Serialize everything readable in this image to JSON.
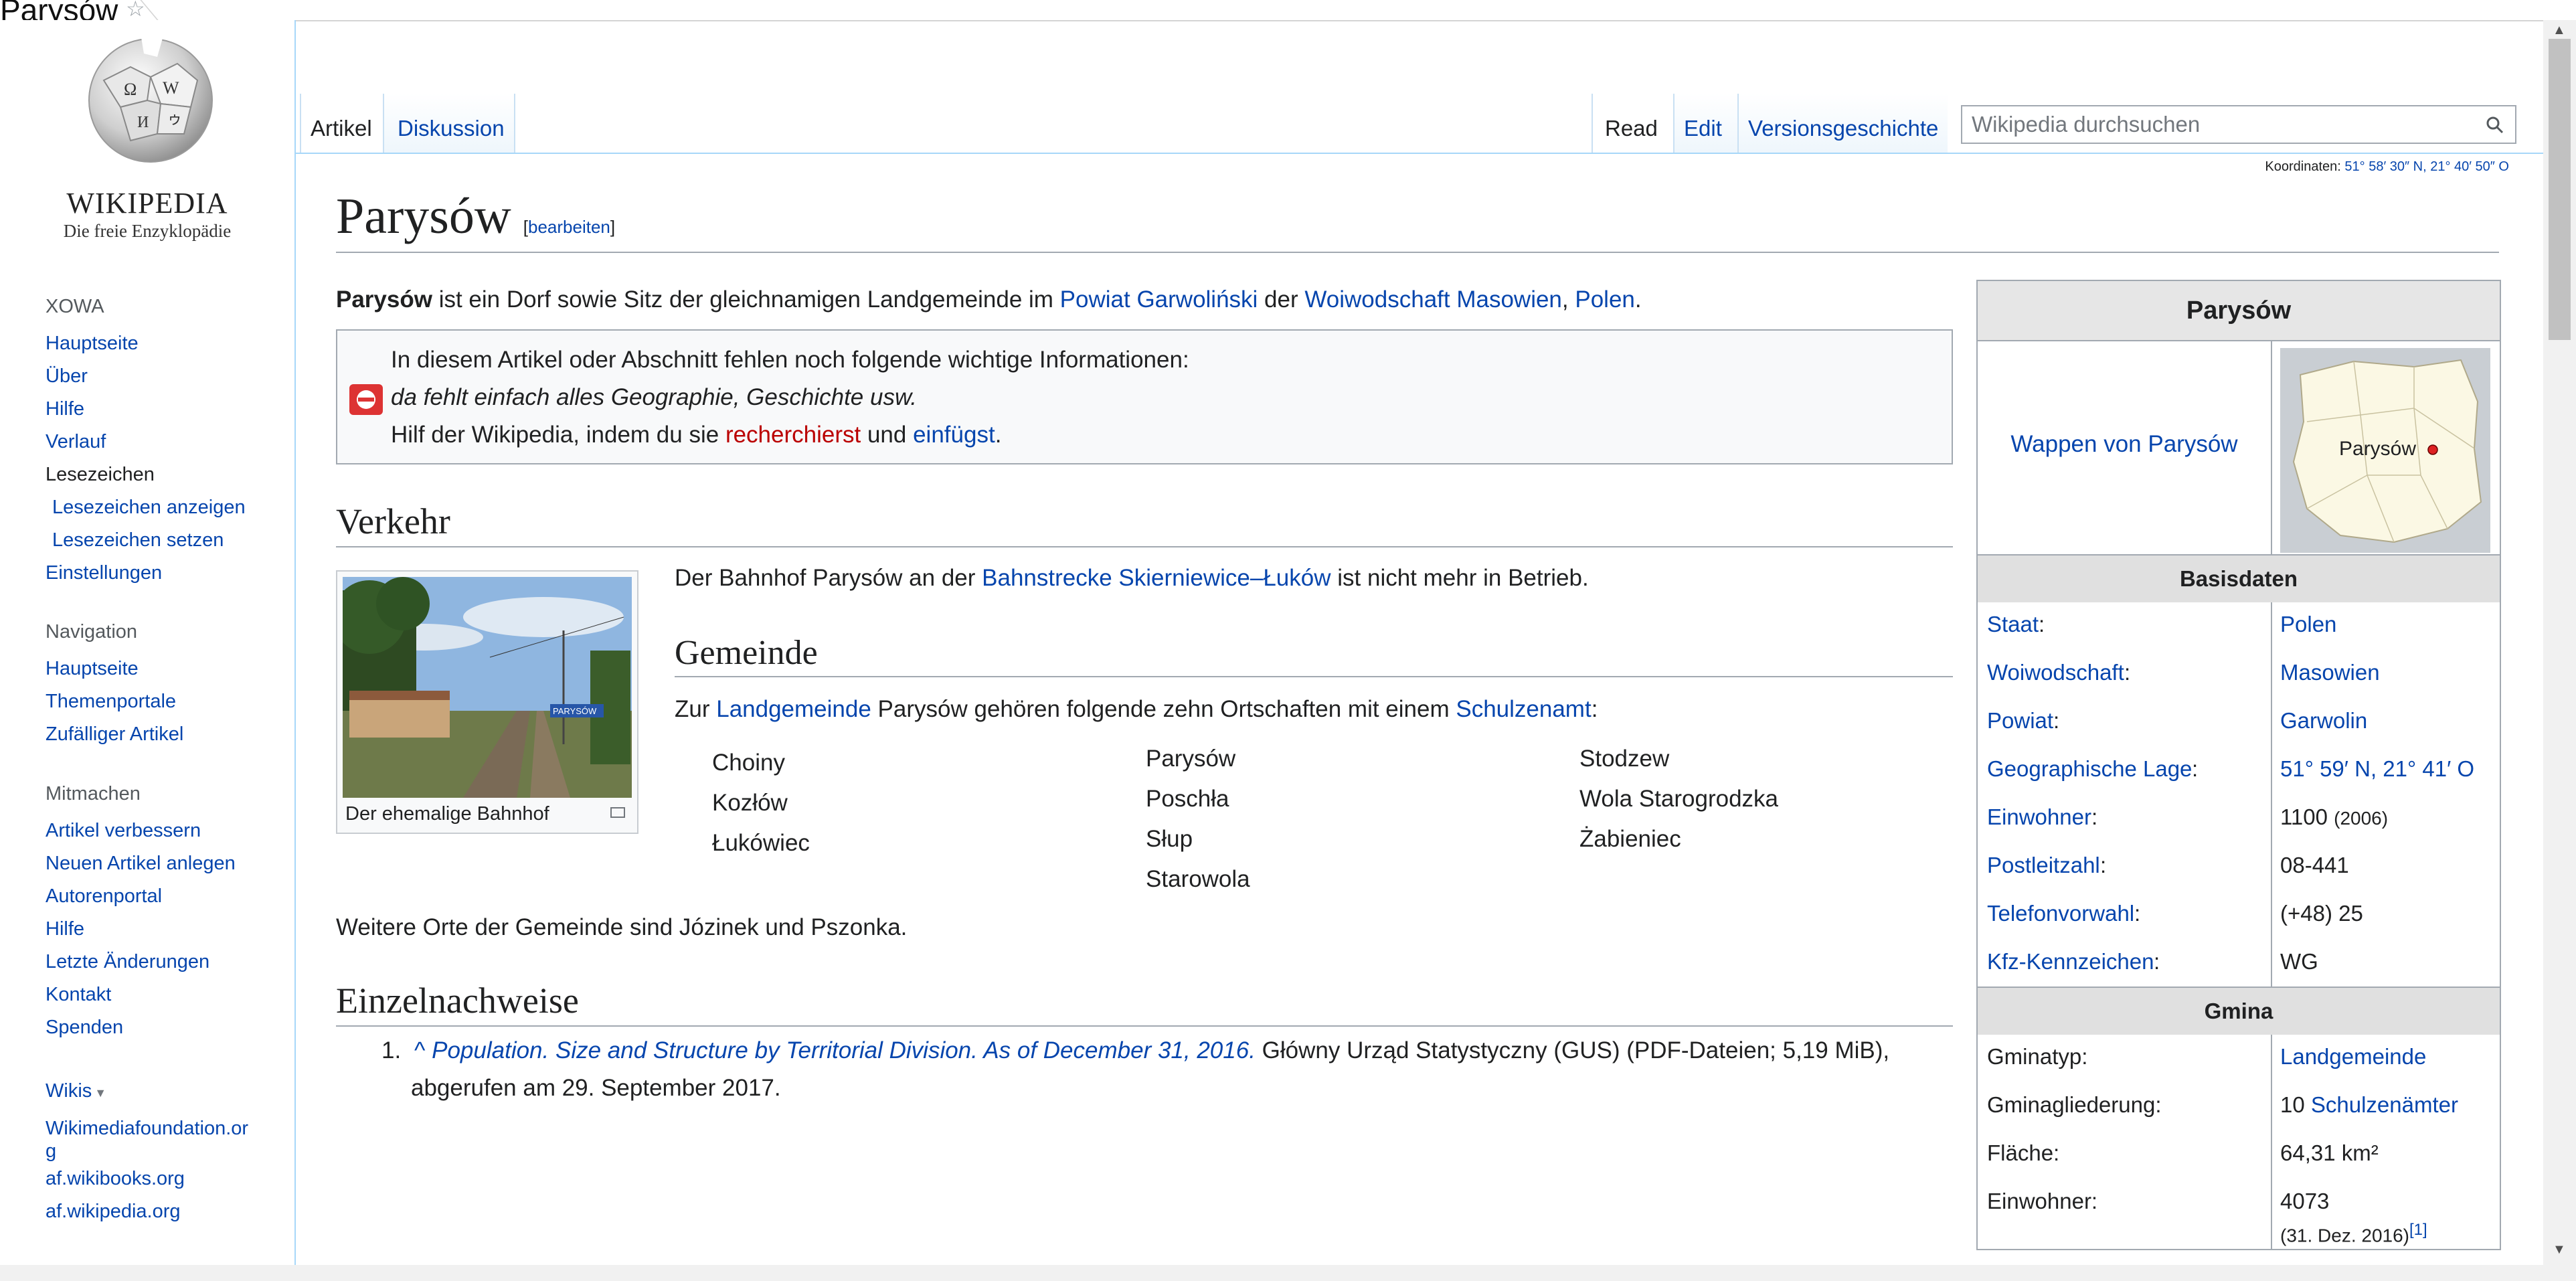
{
  "tab": {
    "title": "Parysów"
  },
  "logo": {
    "wordmark": "WIKIPEDIA",
    "tagline": "Die freie Enzyklopädie"
  },
  "sidebar": {
    "sections": [
      {
        "heading": "XOWA",
        "items": [
          {
            "label": "Hauptseite",
            "type": "link"
          },
          {
            "label": "Über",
            "type": "link"
          },
          {
            "label": "Hilfe",
            "type": "link"
          },
          {
            "label": "Verlauf",
            "type": "link"
          },
          {
            "label": "Lesezeichen",
            "type": "plain"
          },
          {
            "label": "Lesezeichen anzeigen",
            "type": "indent"
          },
          {
            "label": "Lesezeichen setzen",
            "type": "indent"
          },
          {
            "label": "Einstellungen",
            "type": "link"
          }
        ]
      },
      {
        "heading": "Navigation",
        "items": [
          {
            "label": "Hauptseite",
            "type": "link"
          },
          {
            "label": "Themenportale",
            "type": "link"
          },
          {
            "label": "Zufälliger Artikel",
            "type": "link"
          }
        ]
      },
      {
        "heading": "Mitmachen",
        "items": [
          {
            "label": "Artikel verbessern",
            "type": "link"
          },
          {
            "label": "Neuen Artikel anlegen",
            "type": "link"
          },
          {
            "label": "Autorenportal",
            "type": "link"
          },
          {
            "label": "Hilfe",
            "type": "link"
          },
          {
            "label": "Letzte Änderungen",
            "type": "link"
          },
          {
            "label": "Kontakt",
            "type": "link"
          },
          {
            "label": "Spenden",
            "type": "link"
          }
        ]
      },
      {
        "heading": "Wikis",
        "items": [
          {
            "label": "Wikimediafoundation.or",
            "type": "link"
          },
          {
            "label": "g",
            "type": "link"
          },
          {
            "label": "af.wikibooks.org",
            "type": "link"
          },
          {
            "label": "af.wikipedia.org",
            "type": "link"
          }
        ]
      }
    ]
  },
  "tabs": {
    "article": "Artikel",
    "discussion": "Diskussion",
    "read": "Read",
    "edit": "Edit",
    "history": "Versionsgeschichte"
  },
  "search": {
    "placeholder": "Wikipedia durchsuchen",
    "value": ""
  },
  "coordinates": {
    "label": "Koordinaten:",
    "value": "51° 58′ 30″ N, 21° 40′ 50″ O"
  },
  "article": {
    "title": "Parysów",
    "edit_link": "bearbeiten",
    "intro": {
      "subject": "Parysów",
      "text1": " ist ein Dorf sowie Sitz der gleichnamigen Landgemeinde im ",
      "link1": "Powiat Garwoliński",
      "text2": " der ",
      "link2": "Woiwodschaft Masowien",
      "text3": ", ",
      "link3": "Polen",
      "text4": "."
    },
    "notice": {
      "line1": "In diesem Artikel oder Abschnitt fehlen noch folgende wichtige Informationen:",
      "line2": "da fehlt einfach alles Geographie, Geschichte usw.",
      "line3a": "Hilf der Wikipedia, indem du sie ",
      "line3_link1": "recherchierst",
      "line3b": " und ",
      "line3_link2": "einfügst",
      "line3c": "."
    },
    "section_verkehr": "Verkehr",
    "thumb_caption": "Der ehemalige Bahnhof",
    "thumb_sign": "PARYSÓW",
    "verkehr_text": {
      "a": "Der Bahnhof Parysów an der ",
      "link": "Bahnstrecke Skierniewice–Łuków",
      "b": " ist nicht mehr in Betrieb."
    },
    "section_gemeinde": "Gemeinde",
    "gemeinde_text": {
      "a": "Zur ",
      "link1": "Landgemeinde",
      "b": " Parysów gehören folgende zehn Ortschaften mit einem ",
      "link2": "Schulzenamt",
      "c": ":"
    },
    "places": {
      "col1": [
        "Choiny",
        "Kozłów",
        "Łukówiec"
      ],
      "col2": [
        "Parysów",
        "Poschła",
        "Słup",
        "Starowola"
      ],
      "col3": [
        "Stodzew",
        "Wola Starogrodzka",
        "Żabieniec"
      ]
    },
    "weitere": "Weitere Orte der Gemeinde sind Józinek und Pszonka.",
    "section_refs": "Einzelnachweise",
    "ref": {
      "num": "1.",
      "caret": "^",
      "title": "Population. Size and Structure by Territorial Division. As of December 31, 2016.",
      "rest1": " Główny Urząd Statystyczny (GUS) (PDF-Dateien; 5,19 MiB),",
      "rest2": "abgerufen am 29. September 2017."
    }
  },
  "infobox": {
    "title": "Parysów",
    "wappen_link": "Wappen von Parysów",
    "map_label": "Parysów",
    "head_basis": "Basisdaten",
    "rows": [
      {
        "label": "Staat",
        "value": "Polen",
        "label_link": true,
        "value_link": true
      },
      {
        "label": "Woiwodschaft",
        "value": "Masowien",
        "label_link": true,
        "value_link": true
      },
      {
        "label": "Powiat",
        "value": "Garwolin",
        "label_link": true,
        "value_link": true
      },
      {
        "label": "Geographische Lage",
        "value": "51° 59′ N, 21° 41′ O",
        "label_link": true,
        "value_link": true
      },
      {
        "label": "Einwohner",
        "value": "1100",
        "note": "(2006)",
        "label_link": true,
        "value_link": false
      },
      {
        "label": "Postleitzahl",
        "value": "08-441",
        "label_link": true,
        "value_link": false
      },
      {
        "label": "Telefonvorwahl",
        "value": "(+48) 25",
        "label_link": true,
        "value_link": false
      },
      {
        "label": "Kfz-Kennzeichen",
        "value": "WG",
        "label_link": true,
        "value_link": false
      }
    ],
    "head_gmina": "Gmina",
    "gmina_rows": [
      {
        "label": "Gminatyp:",
        "value": "Landgemeinde",
        "value_link": true
      },
      {
        "label": "Gminagliederung:",
        "prefix": "10 ",
        "value": "Schulzenämter",
        "value_link": true
      },
      {
        "label": "Fläche:",
        "value": "64,31 km²",
        "value_link": false
      },
      {
        "label": "Einwohner:",
        "value": "4073",
        "sub": "(31. Dez. 2016)",
        "sup": "[1]",
        "value_link": false
      }
    ]
  },
  "colors": {
    "link": "#0645ad",
    "redlink": "#ba0000",
    "border": "#a2a9b1",
    "accent": "#a7d7f9"
  }
}
